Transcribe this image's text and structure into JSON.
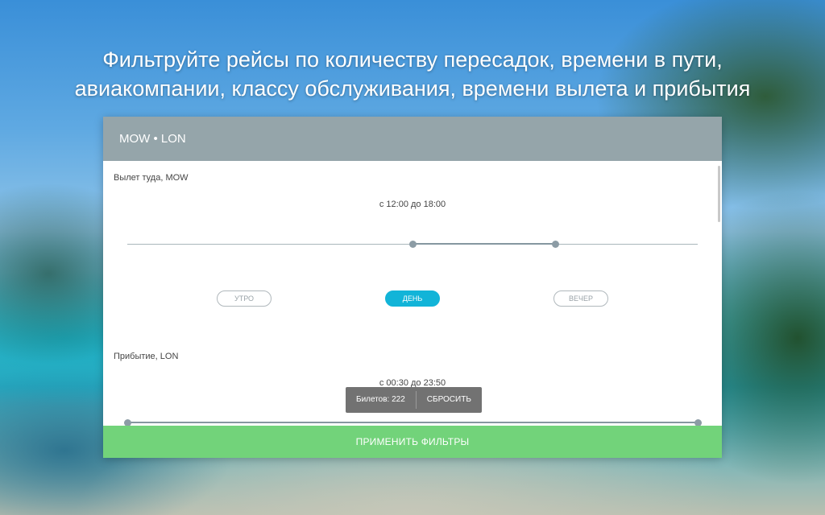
{
  "headline": {
    "line1": "Фильтруйте рейсы по количеству пересадок, времени в пути,",
    "line2": "авиакомпании, классу обслуживания, времени вылета и прибытия"
  },
  "panel": {
    "title": "MOW • LON",
    "departure": {
      "title": "Вылет туда, MOW",
      "range_text": "с 12:00 до 18:00",
      "range_start_fraction": 0.5,
      "range_end_fraction": 0.75,
      "chips": [
        {
          "label": "УТРО",
          "active": false
        },
        {
          "label": "ДЕНЬ",
          "active": true
        },
        {
          "label": "ВЕЧЕР",
          "active": false
        }
      ]
    },
    "arrival": {
      "title": "Прибытие, LON",
      "range_text": "с 00:30 до 23:50",
      "range_start_fraction": 0.0,
      "range_end_fraction": 1.0
    },
    "toast": {
      "tickets": "Билетов: 222",
      "reset": "СБРОСИТЬ"
    },
    "apply_label": "ПРИМЕНИТЬ ФИЛЬТРЫ"
  },
  "colors": {
    "header": "#95a5aa",
    "active_chip": "#12b4d8",
    "apply": "#72d37a"
  }
}
